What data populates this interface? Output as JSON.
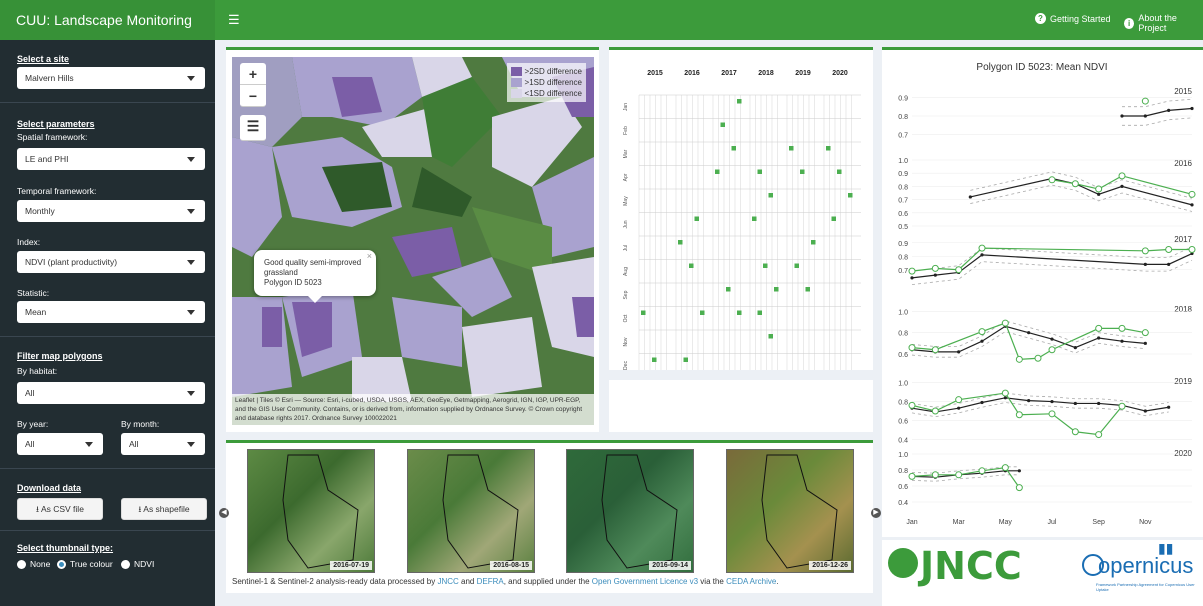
{
  "app": {
    "title": "CUU: Landscape Monitoring",
    "getting_started": "Getting Started",
    "about": "About the Project"
  },
  "sidebar": {
    "site_header": "Select a site",
    "site_value": "Malvern Hills",
    "params_header": "Select parameters",
    "spatial_label": "Spatial framework:",
    "spatial_value": "LE and PHI",
    "temporal_label": "Temporal framework:",
    "temporal_value": "Monthly",
    "index_label": "Index:",
    "index_value": "NDVI (plant productivity)",
    "statistic_label": "Statistic:",
    "statistic_value": "Mean",
    "filter_header": "Filter map polygons",
    "habitat_label": "By habitat:",
    "habitat_value": "All",
    "year_label": "By year:",
    "year_value": "All",
    "month_label": "By month:",
    "month_value": "All",
    "download_header": "Download data",
    "csv_btn": "As CSV file",
    "shp_btn": "As shapefile",
    "thumb_header": "Select thumbnail type:",
    "thumb_options": [
      "None",
      "True colour",
      "NDVI"
    ],
    "thumb_selected": "True colour"
  },
  "map": {
    "legend": [
      ">2SD difference",
      ">1SD difference",
      "<1SD difference"
    ],
    "legend_colors": [
      "#7b5ea7",
      "#a9a2cf",
      "#d9d6e8"
    ],
    "popup_line1": "Good quality semi-improved",
    "popup_line2": "grassland",
    "popup_line3": "Polygon ID 5023",
    "attribution": "Leaflet | Tiles © Esri — Source: Esri, i-cubed, USDA, USGS, AEX, GeoEye, Getmapping, Aerogrid, IGN, IGP, UPR-EGP, and the GIS User Community. Contains, or is derived from, information supplied by Ordnance Survey. © Crown copyright and database rights 2017. Ordnance Survey 100022021"
  },
  "calendar": {
    "years": [
      "2015",
      "2016",
      "2017",
      "2018",
      "2019",
      "2020"
    ],
    "months": [
      "Jan",
      "Feb",
      "Mar",
      "Apr",
      "May",
      "Jun",
      "Jul",
      "Aug",
      "Sep",
      "Oct",
      "Nov",
      "Dec"
    ]
  },
  "thumbnails": [
    {
      "date": "2016-07-19"
    },
    {
      "date": "2016-08-15"
    },
    {
      "date": "2016-09-14"
    },
    {
      "date": "2016-12-26"
    }
  ],
  "caption": {
    "pre": "Sentinel-1 & Sentinel-2 analysis-ready data processed by ",
    "jncc": "JNCC",
    "and": " and ",
    "defra": "DEFRA",
    "mid": ", and supplied under the ",
    "ogl": "Open Government Licence v3",
    "via": " via the ",
    "ceda": "CEDA Archive",
    "end": "."
  },
  "logos": {
    "jncc": "JNCC",
    "copernicus": "opernicus",
    "copernicus_sub": "Framework Partnership Agreement for Copernicus User Uptake"
  },
  "chart_data": {
    "type": "line",
    "title": "Polygon ID 5023: Mean NDVI",
    "x_ticks": [
      "Jan",
      "Mar",
      "May",
      "Jul",
      "Sep",
      "Nov"
    ],
    "panels": [
      {
        "year": "2015",
        "yticks": [
          "0.9",
          "0.8",
          "0.7"
        ],
        "ylim": [
          0.65,
          0.95
        ],
        "black": [
          [
            10,
            0.8
          ],
          [
            11,
            0.8
          ],
          [
            12,
            0.83
          ],
          [
            13,
            0.84
          ]
        ],
        "green": [
          [
            11,
            0.88
          ]
        ]
      },
      {
        "year": "2016",
        "yticks": [
          "1.0",
          "0.9",
          "0.8",
          "0.7",
          "0.6",
          "0.5"
        ],
        "ylim": [
          0.5,
          1.0
        ],
        "black": [
          [
            3.5,
            0.72
          ],
          [
            7,
            0.86
          ],
          [
            8,
            0.82
          ],
          [
            9,
            0.74
          ],
          [
            10,
            0.8
          ],
          [
            13,
            0.66
          ]
        ],
        "green": [
          [
            7,
            0.85
          ],
          [
            8,
            0.82
          ],
          [
            9,
            0.78
          ],
          [
            10,
            0.88
          ],
          [
            13,
            0.74
          ]
        ]
      },
      {
        "year": "2017",
        "yticks": [
          "0.9",
          "0.8",
          "0.7"
        ],
        "ylim": [
          0.55,
          0.95
        ],
        "black": [
          [
            1,
            0.64
          ],
          [
            2,
            0.66
          ],
          [
            3,
            0.68
          ],
          [
            4,
            0.81
          ],
          [
            11,
            0.74
          ],
          [
            12,
            0.74
          ],
          [
            13,
            0.82
          ]
        ],
        "green": [
          [
            1,
            0.69
          ],
          [
            2,
            0.71
          ],
          [
            3,
            0.7
          ],
          [
            4,
            0.86
          ],
          [
            11,
            0.84
          ],
          [
            12,
            0.85
          ],
          [
            13,
            0.85
          ]
        ]
      },
      {
        "year": "2018",
        "yticks": [
          "1.0",
          "0.8",
          "0.6"
        ],
        "ylim": [
          0.45,
          1.05
        ],
        "black": [
          [
            1,
            0.64
          ],
          [
            2,
            0.62
          ],
          [
            3,
            0.62
          ],
          [
            4,
            0.72
          ],
          [
            5,
            0.86
          ],
          [
            6,
            0.8
          ],
          [
            7,
            0.74
          ],
          [
            8,
            0.66
          ],
          [
            9,
            0.75
          ],
          [
            10,
            0.72
          ],
          [
            11,
            0.7
          ]
        ],
        "green": [
          [
            1,
            0.66
          ],
          [
            2,
            0.64
          ],
          [
            4,
            0.81
          ],
          [
            5,
            0.89
          ],
          [
            5.6,
            0.55
          ],
          [
            6.4,
            0.56
          ],
          [
            7,
            0.64
          ],
          [
            9,
            0.84
          ],
          [
            10,
            0.84
          ],
          [
            11,
            0.8
          ]
        ]
      },
      {
        "year": "2019",
        "yticks": [
          "1.0",
          "0.8",
          "0.6",
          "0.4"
        ],
        "ylim": [
          0.35,
          1.05
        ],
        "black": [
          [
            1,
            0.73
          ],
          [
            2,
            0.69
          ],
          [
            3,
            0.73
          ],
          [
            4,
            0.79
          ],
          [
            5,
            0.84
          ],
          [
            6,
            0.81
          ],
          [
            7,
            0.8
          ],
          [
            8,
            0.78
          ],
          [
            9,
            0.78
          ],
          [
            10,
            0.76
          ],
          [
            11,
            0.7
          ],
          [
            12,
            0.74
          ]
        ],
        "green": [
          [
            1,
            0.76
          ],
          [
            2,
            0.7
          ],
          [
            3,
            0.82
          ],
          [
            5,
            0.89
          ],
          [
            5.6,
            0.66
          ],
          [
            7,
            0.67
          ],
          [
            8,
            0.48
          ],
          [
            9,
            0.45
          ],
          [
            10,
            0.75
          ]
        ]
      },
      {
        "year": "2020",
        "yticks": [
          "1.0",
          "0.8",
          "0.6",
          "0.4"
        ],
        "ylim": [
          0.35,
          1.05
        ],
        "black": [
          [
            1,
            0.72
          ],
          [
            2,
            0.71
          ],
          [
            3,
            0.74
          ],
          [
            4,
            0.76
          ],
          [
            5,
            0.79
          ],
          [
            5.6,
            0.79
          ]
        ],
        "green": [
          [
            1,
            0.72
          ],
          [
            2,
            0.74
          ],
          [
            3,
            0.74
          ],
          [
            4,
            0.79
          ],
          [
            5,
            0.83
          ],
          [
            5.6,
            0.58
          ]
        ]
      }
    ]
  },
  "calendar_marks": [
    [
      0,
      9
    ],
    [
      0,
      11
    ],
    [
      1,
      9
    ],
    [
      1,
      11
    ],
    [
      1,
      5
    ],
    [
      1,
      6
    ],
    [
      1,
      7
    ],
    [
      2,
      0
    ],
    [
      2,
      1
    ],
    [
      2,
      2
    ],
    [
      2,
      3
    ],
    [
      2,
      8
    ],
    [
      2,
      9
    ],
    [
      3,
      3
    ],
    [
      3,
      4
    ],
    [
      3,
      5
    ],
    [
      3,
      7
    ],
    [
      3,
      8
    ],
    [
      3,
      9
    ],
    [
      3,
      10
    ],
    [
      4,
      2
    ],
    [
      4,
      3
    ],
    [
      4,
      6
    ],
    [
      4,
      7
    ],
    [
      4,
      8
    ],
    [
      5,
      2
    ],
    [
      5,
      3
    ],
    [
      5,
      4
    ],
    [
      5,
      5
    ]
  ]
}
